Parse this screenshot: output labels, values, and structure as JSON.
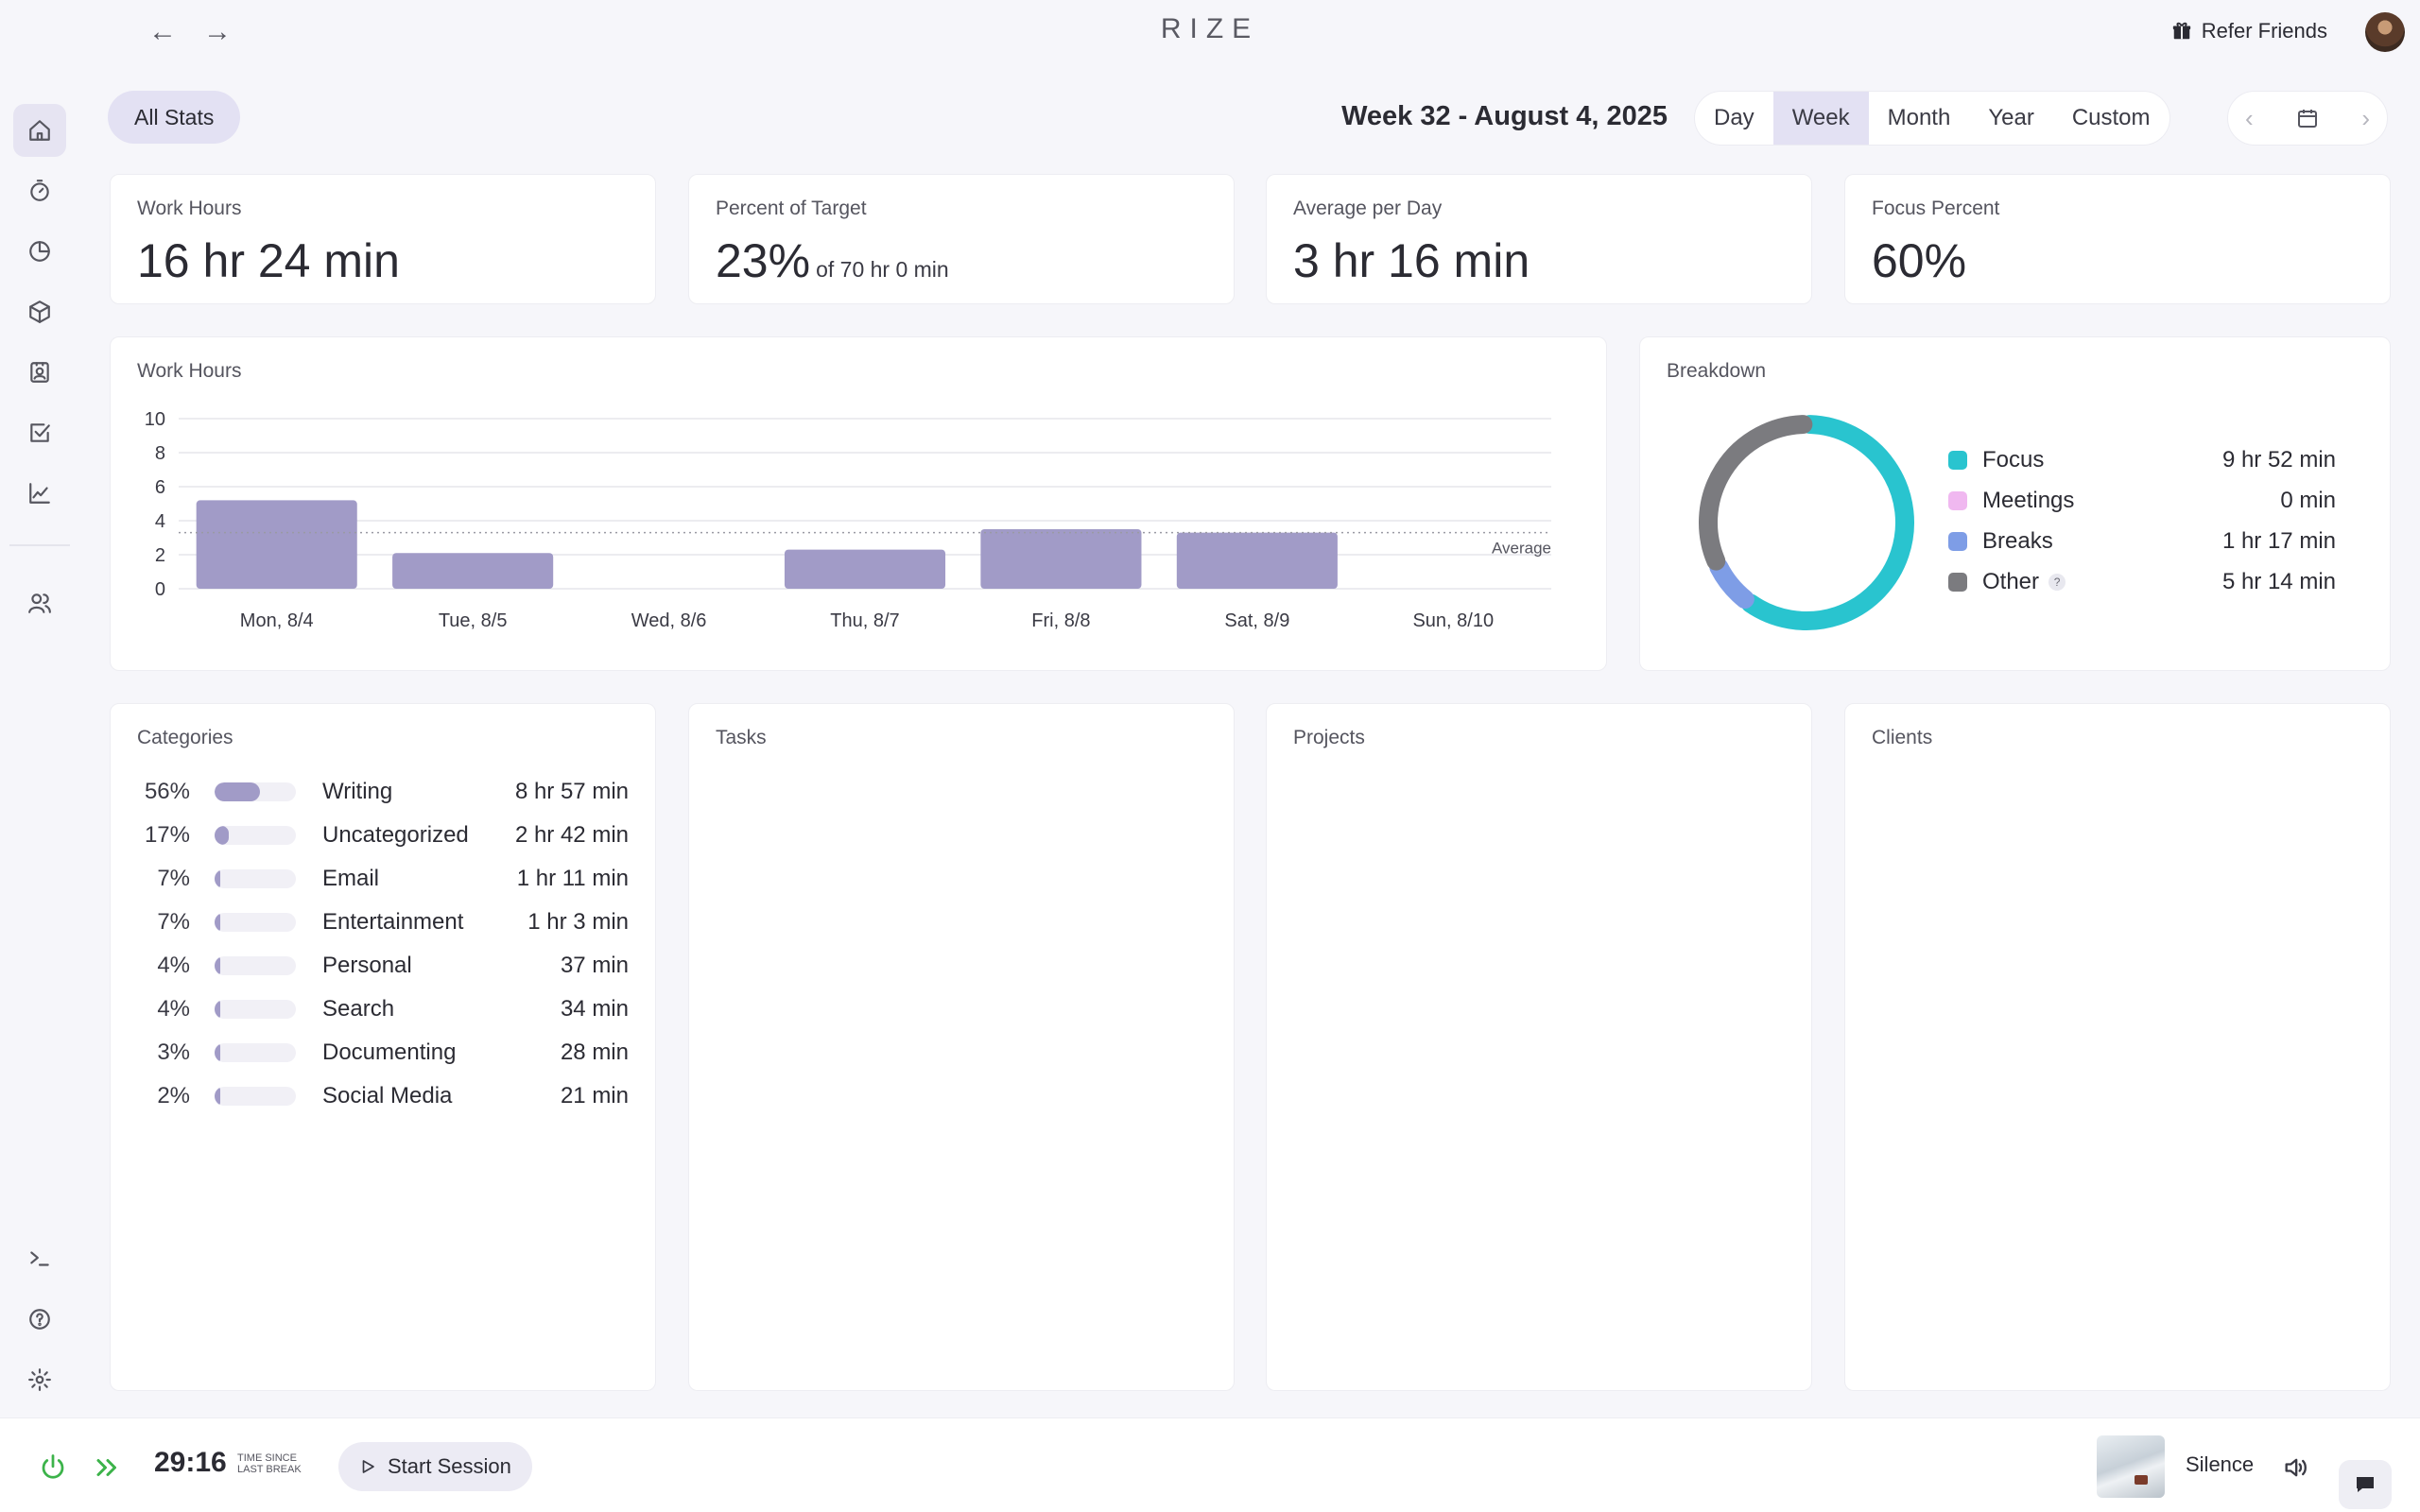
{
  "app": {
    "title": "RIZE",
    "refer_label": "Refer Friends",
    "avatar_icon": "user-avatar"
  },
  "nav": {
    "back_icon": "←",
    "forward_icon": "→"
  },
  "sidebar": {
    "items": [
      {
        "icon": "home-icon"
      },
      {
        "icon": "timer-icon"
      },
      {
        "icon": "pie-chart-icon"
      },
      {
        "icon": "cube-icon"
      },
      {
        "icon": "contact-card-icon"
      },
      {
        "icon": "checkbox-icon"
      },
      {
        "icon": "line-chart-icon"
      },
      {
        "icon": "users-icon"
      }
    ],
    "bottom_items": [
      {
        "icon": "terminal-icon"
      },
      {
        "icon": "help-icon"
      },
      {
        "icon": "settings-icon"
      }
    ]
  },
  "header": {
    "all_stats": "All Stats",
    "week_title": "Week 32 - August 4, 2025",
    "ranges": [
      "Day",
      "Week",
      "Month",
      "Year",
      "Custom"
    ],
    "active_range": "Week"
  },
  "stats": [
    {
      "label": "Work Hours",
      "value": "16 hr 24 min",
      "sub": ""
    },
    {
      "label": "Percent of Target",
      "value": "23%",
      "sub": "of 70 hr 0 min"
    },
    {
      "label": "Average per Day",
      "value": "3 hr 16 min",
      "sub": ""
    },
    {
      "label": "Focus Percent",
      "value": "60%",
      "sub": ""
    }
  ],
  "work_chart": {
    "label": "Work Hours",
    "average_label": "Average"
  },
  "chart_data": {
    "type": "bar",
    "categories": [
      "Mon, 8/4",
      "Tue, 8/5",
      "Wed, 8/6",
      "Thu, 8/7",
      "Fri, 8/8",
      "Sat, 8/9",
      "Sun, 8/10"
    ],
    "values": [
      5.2,
      2.1,
      0,
      2.3,
      3.5,
      3.3,
      0
    ],
    "average": 3.3,
    "ylim": [
      0,
      10
    ],
    "yticks": [
      0,
      2,
      4,
      6,
      8,
      10
    ],
    "grid": true,
    "color": "#a19bc7"
  },
  "breakdown": {
    "label": "Breakdown",
    "items": [
      {
        "name": "Focus",
        "value": "9 hr 52 min",
        "minutes": 592,
        "color": "#29c4cf",
        "help": ""
      },
      {
        "name": "Meetings",
        "value": "0 min",
        "minutes": 0,
        "color": "#f0b8f0",
        "help": ""
      },
      {
        "name": "Breaks",
        "value": "1 hr 17 min",
        "minutes": 77,
        "color": "#7e9de6",
        "help": ""
      },
      {
        "name": "Other",
        "value": "5 hr 14 min",
        "minutes": 314,
        "color": "#7b7b7f",
        "help": "?"
      }
    ]
  },
  "categories": {
    "label": "Categories",
    "rows": [
      {
        "pct": "56%",
        "fraction": 0.56,
        "name": "Writing",
        "time": "8 hr 57 min"
      },
      {
        "pct": "17%",
        "fraction": 0.17,
        "name": "Uncategorized",
        "time": "2 hr 42 min"
      },
      {
        "pct": "7%",
        "fraction": 0.07,
        "name": "Email",
        "time": "1 hr 11 min"
      },
      {
        "pct": "7%",
        "fraction": 0.07,
        "name": "Entertainment",
        "time": "1 hr 3 min"
      },
      {
        "pct": "4%",
        "fraction": 0.04,
        "name": "Personal",
        "time": "37 min"
      },
      {
        "pct": "4%",
        "fraction": 0.04,
        "name": "Search",
        "time": "34 min"
      },
      {
        "pct": "3%",
        "fraction": 0.03,
        "name": "Documenting",
        "time": "28 min"
      },
      {
        "pct": "2%",
        "fraction": 0.02,
        "name": "Social Media",
        "time": "21 min"
      }
    ]
  },
  "panels": {
    "tasks": "Tasks",
    "projects": "Projects",
    "clients": "Clients"
  },
  "bottom": {
    "timer": "29:16",
    "timer_caption": "TIME SINCE LAST BREAK",
    "start_session": "Start Session",
    "sound": "Silence",
    "accent": "#3cb34a"
  }
}
